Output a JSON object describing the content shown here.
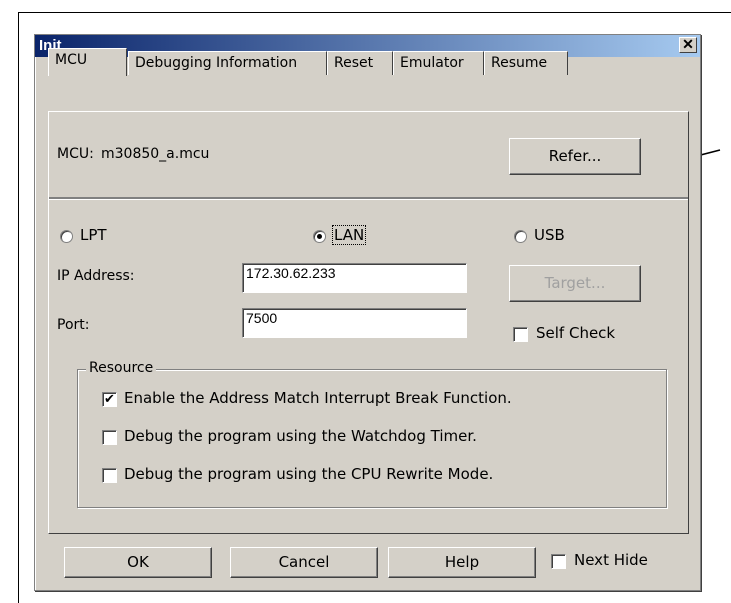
{
  "window": {
    "title": "Init",
    "close_label": "✕"
  },
  "tabs": [
    "MCU",
    "Debugging Information",
    "Reset",
    "Emulator",
    "Resume"
  ],
  "mcu": {
    "label": "MCU:",
    "value": "m30850_a.mcu",
    "refer_button": "Refer..."
  },
  "connection": {
    "options": [
      "LPT",
      "LAN",
      "USB"
    ],
    "selected": "LAN",
    "ip_label": "IP Address:",
    "ip_value": "172.30.62.233",
    "port_label": "Port:",
    "port_value": "7500",
    "target_button": "Target...",
    "self_check_label": "Self Check",
    "self_check_checked": false
  },
  "resource": {
    "title": "Resource",
    "items": [
      {
        "label": "Enable the Address Match Interrupt Break Function.",
        "checked": true
      },
      {
        "label": "Debug the program using the Watchdog Timer.",
        "checked": false
      },
      {
        "label": "Debug the program using the CPU Rewrite Mode.",
        "checked": false
      }
    ]
  },
  "footer": {
    "ok": "OK",
    "cancel": "Cancel",
    "help": "Help",
    "next_hide": "Next Hide",
    "next_hide_checked": false
  }
}
